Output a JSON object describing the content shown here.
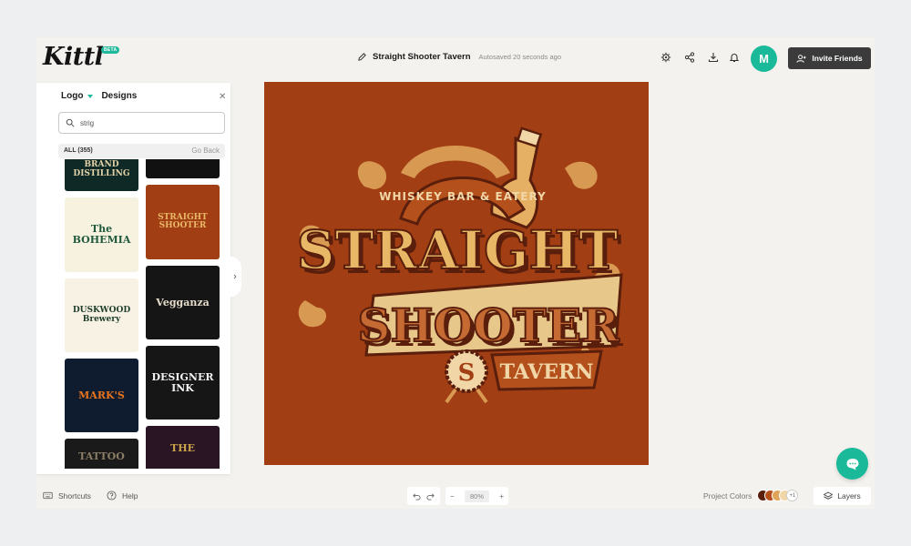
{
  "app": {
    "logo": "Kittl",
    "beta_badge": "BETA"
  },
  "header": {
    "project_title": "Straight Shooter Tavern",
    "autosave": "Autosaved 20 seconds ago",
    "avatar_initial": "M",
    "invite_label": "Invite Friends",
    "icons": [
      "settings-icon",
      "share-icon",
      "download-icon",
      "bell-icon"
    ]
  },
  "panel": {
    "tab_logo": "Logo",
    "tab_designs": "Designs",
    "search": {
      "value": "strig",
      "placeholder": "Search"
    },
    "all_count": "ALL (355)",
    "go_back": "Go Back",
    "thumbnails": [
      {
        "text": "BRAND\nDISTILLING",
        "bg": "#0f2a26",
        "fg": "#e3d2a8"
      },
      {
        "text": "",
        "bg": "#111111",
        "fg": "#c7a24a"
      },
      {
        "text": "The\nBOHEMIA",
        "bg": "#f7f1df",
        "fg": "#1f5a3c"
      },
      {
        "text": "STRAIGHT\nSHOOTER",
        "bg": "#a23e14",
        "fg": "#e8b866"
      },
      {
        "text": "DUSKWOOD\nBrewery",
        "bg": "#f7f2e4",
        "fg": "#1f3d2b"
      },
      {
        "text": "Vegganza",
        "bg": "#151515",
        "fg": "#e6dccb"
      },
      {
        "text": "MARK'S",
        "bg": "#0f1b2e",
        "fg": "#e9751f"
      },
      {
        "text": "DESIGNER\nINK",
        "bg": "#161616",
        "fg": "#f2f2f2"
      },
      {
        "text": "TATTOO",
        "bg": "#1a1a1a",
        "fg": "#8a7d66"
      },
      {
        "text": "THE",
        "bg": "#2a1525",
        "fg": "#c9a24a"
      }
    ]
  },
  "artwork": {
    "tagline": "WHISKEY BAR & EATERY",
    "line1": "STRAIGHT",
    "line2": "SHOOTER",
    "line3": "TAVERN",
    "monogram": "S",
    "background": "#a23e14"
  },
  "footer": {
    "shortcuts": "Shortcuts",
    "help": "Help",
    "zoom_minus": "−",
    "zoom": "80%",
    "zoom_plus": "+",
    "project_colors_label": "Project Colors",
    "project_colors": [
      "#5a1e0c",
      "#b4501c",
      "#e0a35a",
      "#f1d7a8"
    ],
    "more_colors": "+1",
    "layers": "Layers"
  }
}
